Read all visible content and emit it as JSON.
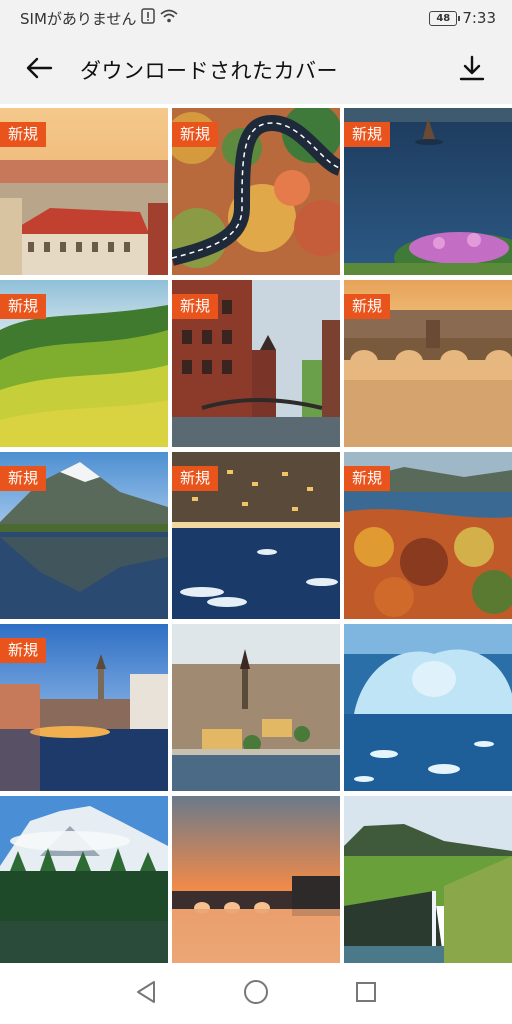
{
  "status_bar": {
    "carrier": "SIMがありません",
    "battery": "48",
    "time": "7:33"
  },
  "app_bar": {
    "title": "ダウンロードされたカバー",
    "back_icon": "arrow-left-icon",
    "download_icon": "download-icon"
  },
  "covers": [
    {
      "subject": "city-rooftops",
      "badge": "新規"
    },
    {
      "subject": "winding-road-forest",
      "badge": "新規"
    },
    {
      "subject": "lake-rock-flowers",
      "badge": "新規"
    },
    {
      "subject": "green-hills",
      "badge": "新規"
    },
    {
      "subject": "brick-canal",
      "badge": "新規"
    },
    {
      "subject": "stone-bridge-river",
      "badge": "新規"
    },
    {
      "subject": "mountain-lake",
      "badge": "新規"
    },
    {
      "subject": "harbor-night",
      "badge": "新規"
    },
    {
      "subject": "autumn-lake",
      "badge": "新規"
    },
    {
      "subject": "canal-town-dusk",
      "badge": "新規"
    },
    {
      "subject": "city-aerial",
      "badge": ""
    },
    {
      "subject": "iceberg-arch",
      "badge": ""
    },
    {
      "subject": "snowy-mountain-forest",
      "badge": ""
    },
    {
      "subject": "sunset-bridge",
      "badge": ""
    },
    {
      "subject": "cliff-waterfall",
      "badge": ""
    }
  ],
  "nav_bar": {
    "back_icon": "nav-back-icon",
    "home_icon": "nav-home-icon",
    "recents_icon": "nav-recents-icon"
  }
}
